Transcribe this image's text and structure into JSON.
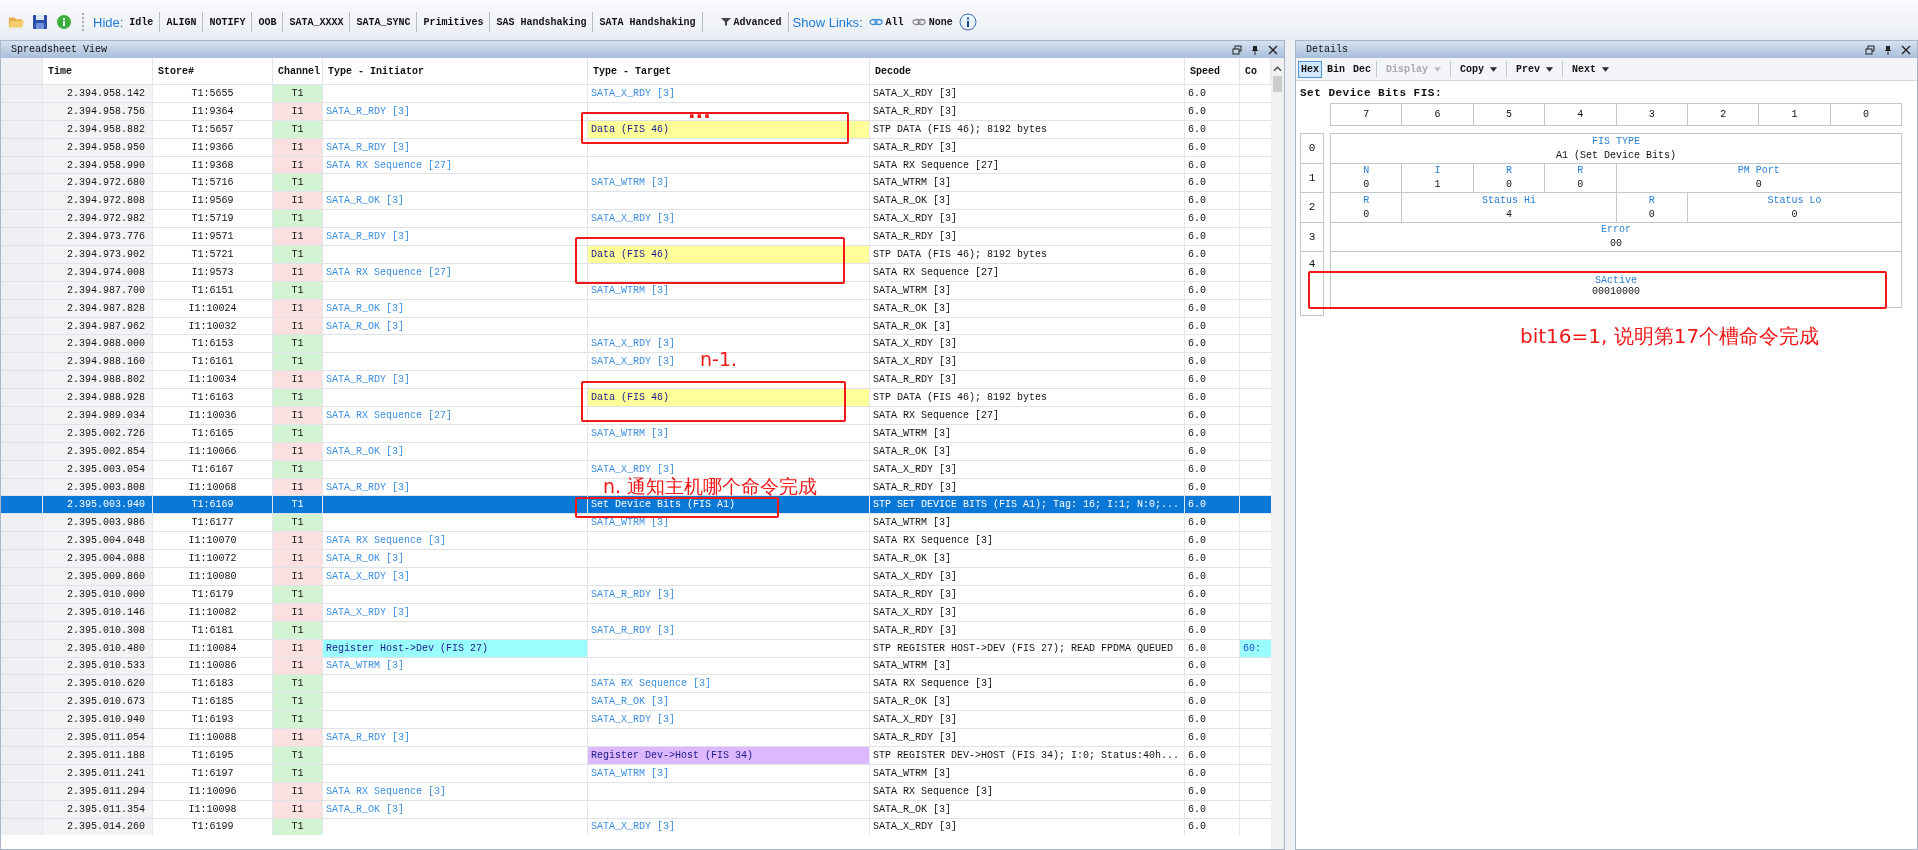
{
  "toolbar": {
    "hide_label": "Hide:",
    "filters": [
      "Idle",
      "ALIGN",
      "NOTIFY",
      "OOB",
      "SATA_XXXX",
      "SATA_SYNC",
      "Primitives",
      "SAS Handshaking",
      "SATA Handshaking"
    ],
    "advanced": "Advanced",
    "links_label": "Show Links:",
    "link_options": [
      "All",
      "None"
    ]
  },
  "spreadsheet": {
    "title": "Spreadsheet View",
    "columns": [
      "Time",
      "Store#",
      "Channel",
      "Type - Initiator",
      "Type - Target",
      "Decode",
      "Speed",
      "Co"
    ],
    "rows": [
      {
        "time": "2.394.958.142",
        "store": "T1:5655",
        "channel": {
          "text": "T1",
          "color": "#d3f3d3"
        },
        "target": {
          "text": "SATA_X_RDY [3]"
        },
        "decode": "SATA_X_RDY [3]",
        "speed": "6.0",
        "selected": false
      },
      {
        "time": "2.394.958.756",
        "store": "I1:9364",
        "channel": {
          "text": "I1",
          "color": "#fbe0e0"
        },
        "initiator": {
          "text": "SATA_R_RDY [3]"
        },
        "decode": "SATA_R_RDY [3]",
        "speed": "6.0",
        "selected": false
      },
      {
        "time": "2.394.958.882",
        "store": "T1:5657",
        "channel": {
          "text": "T1",
          "color": "#d3f3d3"
        },
        "target": {
          "text": "Data (FIS 46)",
          "color": "#ffff99"
        },
        "decode": "STP DATA (FIS 46); 8192 bytes",
        "speed": "6.0",
        "selected": false
      },
      {
        "time": "2.394.958.950",
        "store": "I1:9366",
        "channel": {
          "text": "I1",
          "color": "#fbe0e0"
        },
        "initiator": {
          "text": "SATA_R_RDY [3]"
        },
        "decode": "SATA_R_RDY [3]",
        "speed": "6.0",
        "selected": false
      },
      {
        "time": "2.394.958.990",
        "store": "I1:9368",
        "channel": {
          "text": "I1",
          "color": "#fbe0e0"
        },
        "initiator": {
          "text": "SATA RX Sequence [27]"
        },
        "decode": "SATA RX Sequence [27]",
        "speed": "6.0",
        "selected": false
      },
      {
        "time": "2.394.972.680",
        "store": "T1:5716",
        "channel": {
          "text": "T1",
          "color": "#d3f3d3"
        },
        "target": {
          "text": "SATA_WTRM [3]"
        },
        "decode": "SATA_WTRM [3]",
        "speed": "6.0",
        "selected": false
      },
      {
        "time": "2.394.972.808",
        "store": "I1:9569",
        "channel": {
          "text": "I1",
          "color": "#fbe0e0"
        },
        "initiator": {
          "text": "SATA_R_OK [3]"
        },
        "decode": "SATA_R_OK [3]",
        "speed": "6.0",
        "selected": false
      },
      {
        "time": "2.394.972.982",
        "store": "T1:5719",
        "channel": {
          "text": "T1",
          "color": "#d3f3d3"
        },
        "target": {
          "text": "SATA_X_RDY [3]"
        },
        "decode": "SATA_X_RDY [3]",
        "speed": "6.0",
        "selected": false
      },
      {
        "time": "2.394.973.776",
        "store": "I1:9571",
        "channel": {
          "text": "I1",
          "color": "#fbe0e0"
        },
        "initiator": {
          "text": "SATA_R_RDY [3]"
        },
        "decode": "SATA_R_RDY [3]",
        "speed": "6.0",
        "selected": false
      },
      {
        "time": "2.394.973.902",
        "store": "T1:5721",
        "channel": {
          "text": "T1",
          "color": "#d3f3d3"
        },
        "target": {
          "text": "Data (FIS 46)",
          "color": "#ffff99"
        },
        "decode": "STP DATA (FIS 46); 8192 bytes",
        "speed": "6.0",
        "selected": false
      },
      {
        "time": "2.394.974.008",
        "store": "I1:9573",
        "channel": {
          "text": "I1",
          "color": "#fbe0e0"
        },
        "initiator": {
          "text": "SATA RX Sequence [27]"
        },
        "decode": "SATA RX Sequence [27]",
        "speed": "6.0",
        "selected": false
      },
      {
        "time": "2.394.987.700",
        "store": "T1:6151",
        "channel": {
          "text": "T1",
          "color": "#d3f3d3"
        },
        "target": {
          "text": "SATA_WTRM [3]"
        },
        "decode": "SATA_WTRM [3]",
        "speed": "6.0",
        "selected": false
      },
      {
        "time": "2.394.987.828",
        "store": "I1:10024",
        "channel": {
          "text": "I1",
          "color": "#fbe0e0"
        },
        "initiator": {
          "text": "SATA_R_OK [3]"
        },
        "decode": "SATA_R_OK [3]",
        "speed": "6.0",
        "selected": false
      },
      {
        "time": "2.394.987.962",
        "store": "I1:10032",
        "channel": {
          "text": "I1",
          "color": "#fbe0e0"
        },
        "initiator": {
          "text": "SATA_R_OK [3]"
        },
        "decode": "SATA_R_OK [3]",
        "speed": "6.0",
        "selected": false
      },
      {
        "time": "2.394.988.000",
        "store": "T1:6153",
        "channel": {
          "text": "T1",
          "color": "#d3f3d3"
        },
        "target": {
          "text": "SATA_X_RDY [3]"
        },
        "decode": "SATA_X_RDY [3]",
        "speed": "6.0",
        "selected": false
      },
      {
        "time": "2.394.988.160",
        "store": "T1:6161",
        "channel": {
          "text": "T1",
          "color": "#d3f3d3"
        },
        "target": {
          "text": "SATA_X_RDY [3]"
        },
        "decode": "SATA_X_RDY [3]",
        "speed": "6.0",
        "selected": false
      },
      {
        "time": "2.394.988.802",
        "store": "I1:10034",
        "channel": {
          "text": "I1",
          "color": "#fbe0e0"
        },
        "initiator": {
          "text": "SATA_R_RDY [3]"
        },
        "decode": "SATA_R_RDY [3]",
        "speed": "6.0",
        "selected": false
      },
      {
        "time": "2.394.988.928",
        "store": "T1:6163",
        "channel": {
          "text": "T1",
          "color": "#d3f3d3"
        },
        "target": {
          "text": "Data (FIS 46)",
          "color": "#ffff99"
        },
        "decode": "STP DATA (FIS 46); 8192 bytes",
        "speed": "6.0",
        "selected": false
      },
      {
        "time": "2.394.989.034",
        "store": "I1:10036",
        "channel": {
          "text": "I1",
          "color": "#fbe0e0"
        },
        "initiator": {
          "text": "SATA RX Sequence [27]"
        },
        "decode": "SATA RX Sequence [27]",
        "speed": "6.0",
        "selected": false
      },
      {
        "time": "2.395.002.726",
        "store": "T1:6165",
        "channel": {
          "text": "T1",
          "color": "#d3f3d3"
        },
        "target": {
          "text": "SATA_WTRM [3]"
        },
        "decode": "SATA_WTRM [3]",
        "speed": "6.0",
        "selected": false
      },
      {
        "time": "2.395.002.854",
        "store": "I1:10066",
        "channel": {
          "text": "I1",
          "color": "#fbe0e0"
        },
        "initiator": {
          "text": "SATA_R_OK [3]"
        },
        "decode": "SATA_R_OK [3]",
        "speed": "6.0",
        "selected": false
      },
      {
        "time": "2.395.003.054",
        "store": "T1:6167",
        "channel": {
          "text": "T1",
          "color": "#d3f3d3"
        },
        "target": {
          "text": "SATA_X_RDY [3]"
        },
        "decode": "SATA_X_RDY [3]",
        "speed": "6.0",
        "selected": false
      },
      {
        "time": "2.395.003.808",
        "store": "I1:10068",
        "channel": {
          "text": "I1",
          "color": "#fbe0e0"
        },
        "initiator": {
          "text": "SATA_R_RDY [3]"
        },
        "decode": "SATA_R_RDY [3]",
        "speed": "6.0",
        "selected": false
      },
      {
        "time": "2.395.003.940",
        "store": "T1:6169",
        "channel": {
          "text": "T1"
        },
        "target": {
          "text": "Set Device Bits (FIS A1)"
        },
        "decode": "STP SET DEVICE BITS (FIS A1); Tag: 16; I:1; N:0;...",
        "speed": "6.0",
        "selected": true
      },
      {
        "time": "2.395.003.986",
        "store": "T1:6177",
        "channel": {
          "text": "T1",
          "color": "#d3f3d3"
        },
        "target": {
          "text": "SATA_WTRM [3]"
        },
        "decode": "SATA_WTRM [3]",
        "speed": "6.0",
        "selected": false
      },
      {
        "time": "2.395.004.048",
        "store": "I1:10070",
        "channel": {
          "text": "I1",
          "color": "#fbe0e0"
        },
        "initiator": {
          "text": "SATA RX Sequence [3]"
        },
        "decode": "SATA RX Sequence [3]",
        "speed": "6.0",
        "selected": false
      },
      {
        "time": "2.395.004.088",
        "store": "I1:10072",
        "channel": {
          "text": "I1",
          "color": "#fbe0e0"
        },
        "initiator": {
          "text": "SATA_R_OK [3]"
        },
        "decode": "SATA_R_OK [3]",
        "speed": "6.0",
        "selected": false
      },
      {
        "time": "2.395.009.860",
        "store": "I1:10080",
        "channel": {
          "text": "I1",
          "color": "#fbe0e0"
        },
        "initiator": {
          "text": "SATA_X_RDY [3]"
        },
        "decode": "SATA_X_RDY [3]",
        "speed": "6.0",
        "selected": false
      },
      {
        "time": "2.395.010.000",
        "store": "T1:6179",
        "channel": {
          "text": "T1",
          "color": "#d3f3d3"
        },
        "target": {
          "text": "SATA_R_RDY [3]"
        },
        "decode": "SATA_R_RDY [3]",
        "speed": "6.0",
        "selected": false
      },
      {
        "time": "2.395.010.146",
        "store": "I1:10082",
        "channel": {
          "text": "I1",
          "color": "#fbe0e0"
        },
        "initiator": {
          "text": "SATA_X_RDY [3]"
        },
        "decode": "SATA_X_RDY [3]",
        "speed": "6.0",
        "selected": false
      },
      {
        "time": "2.395.010.308",
        "store": "T1:6181",
        "channel": {
          "text": "T1",
          "color": "#d3f3d3"
        },
        "target": {
          "text": "SATA_R_RDY [3]"
        },
        "decode": "SATA_R_RDY [3]",
        "speed": "6.0",
        "selected": false
      },
      {
        "time": "2.395.010.480",
        "store": "I1:10084",
        "channel": {
          "text": "I1",
          "color": "#fbe0e0"
        },
        "initiator": {
          "text": "Register Host->Dev (FIS 27)",
          "color": "#99ffff"
        },
        "decode": "STP REGISTER HOST->DEV (FIS 27); READ FPDMA QUEUED",
        "speed": "6.0",
        "comment": {
          "text": "60:",
          "color": "#99ffff"
        },
        "selected": false
      },
      {
        "time": "2.395.010.533",
        "store": "I1:10086",
        "channel": {
          "text": "I1",
          "color": "#fbe0e0"
        },
        "initiator": {
          "text": "SATA_WTRM [3]"
        },
        "decode": "SATA_WTRM [3]",
        "speed": "6.0",
        "selected": false
      },
      {
        "time": "2.395.010.620",
        "store": "T1:6183",
        "channel": {
          "text": "T1",
          "color": "#d3f3d3"
        },
        "target": {
          "text": "SATA RX Sequence [3]"
        },
        "decode": "SATA RX Sequence [3]",
        "speed": "6.0",
        "selected": false
      },
      {
        "time": "2.395.010.673",
        "store": "T1:6185",
        "channel": {
          "text": "T1",
          "color": "#d3f3d3"
        },
        "target": {
          "text": "SATA_R_OK [3]"
        },
        "decode": "SATA_R_OK [3]",
        "speed": "6.0",
        "selected": false
      },
      {
        "time": "2.395.010.940",
        "store": "T1:6193",
        "channel": {
          "text": "T1",
          "color": "#d3f3d3"
        },
        "target": {
          "text": "SATA_X_RDY [3]"
        },
        "decode": "SATA_X_RDY [3]",
        "speed": "6.0",
        "selected": false
      },
      {
        "time": "2.395.011.054",
        "store": "I1:10088",
        "channel": {
          "text": "I1",
          "color": "#fbe0e0"
        },
        "initiator": {
          "text": "SATA_R_RDY [3]"
        },
        "decode": "SATA_R_RDY [3]",
        "speed": "6.0",
        "selected": false
      },
      {
        "time": "2.395.011.188",
        "store": "T1:6195",
        "channel": {
          "text": "T1",
          "color": "#d3f3d3"
        },
        "target": {
          "text": "Register Dev->Host (FIS 34)",
          "color": "#ddb8ff"
        },
        "decode": "STP REGISTER DEV->HOST (FIS 34); I:0; Status:40h...",
        "speed": "6.0",
        "selected": false
      },
      {
        "time": "2.395.011.241",
        "store": "T1:6197",
        "channel": {
          "text": "T1",
          "color": "#d3f3d3"
        },
        "target": {
          "text": "SATA_WTRM [3]"
        },
        "decode": "SATA_WTRM [3]",
        "speed": "6.0",
        "selected": false
      },
      {
        "time": "2.395.011.294",
        "store": "I1:10096",
        "channel": {
          "text": "I1",
          "color": "#fbe0e0"
        },
        "initiator": {
          "text": "SATA RX Sequence [3]"
        },
        "decode": "SATA RX Sequence [3]",
        "speed": "6.0",
        "selected": false
      },
      {
        "time": "2.395.011.354",
        "store": "I1:10098",
        "channel": {
          "text": "I1",
          "color": "#fbe0e0"
        },
        "initiator": {
          "text": "SATA_R_OK [3]"
        },
        "decode": "SATA_R_OK [3]",
        "speed": "6.0",
        "selected": false
      },
      {
        "time": "2.395.014.260",
        "store": "T1:6199",
        "channel": {
          "text": "T1",
          "color": "#d3f3d3"
        },
        "target": {
          "text": "SATA_X_RDY [3]"
        },
        "decode": "SATA_X_RDY [3]",
        "speed": "6.0",
        "selected": false
      }
    ]
  },
  "details": {
    "title": "Details",
    "view_modes": [
      {
        "label": "Hex",
        "selected": true
      },
      {
        "label": "Bin",
        "selected": false
      },
      {
        "label": "Dec",
        "selected": false
      }
    ],
    "actions": [
      {
        "label": "Display",
        "disabled": true
      },
      {
        "label": "Copy",
        "disabled": false
      },
      {
        "label": "Prev",
        "disabled": false
      },
      {
        "label": "Next",
        "disabled": false
      }
    ],
    "fis_title": "Set Device Bits FIS:",
    "bit_headers": [
      "7",
      "6",
      "5",
      "4",
      "3",
      "2",
      "1",
      "0"
    ],
    "fis_rows": [
      {
        "index": "0",
        "kind": "byte",
        "fields": [
          {
            "label": "FIS TYPE",
            "value": "A1 (Set Device Bits)",
            "kind": "byte"
          }
        ]
      },
      {
        "index": "1",
        "kind": "byte",
        "fields": [
          {
            "label": "N",
            "value": "0",
            "kind": "bit"
          },
          {
            "label": "I",
            "value": "1",
            "kind": "bit"
          },
          {
            "label": "R",
            "value": "0",
            "kind": "bit"
          },
          {
            "label": "R",
            "value": "0",
            "kind": "bit"
          },
          {
            "label": "PM Port",
            "value": "0",
            "kind": "nibble"
          }
        ]
      },
      {
        "index": "2",
        "kind": "byte",
        "fields": [
          {
            "label": "R",
            "value": "0",
            "kind": "bit"
          },
          {
            "label": "Status Hi",
            "value": "4",
            "kind": "trio"
          },
          {
            "label": "R",
            "value": "0",
            "kind": "bit"
          },
          {
            "label": "Status Lo",
            "value": "0",
            "kind": "trio"
          }
        ]
      },
      {
        "index": "3",
        "kind": "byte",
        "fields": [
          {
            "label": "Error",
            "value": "00",
            "kind": "byte"
          }
        ]
      },
      {
        "index": "4",
        "kind": "dword",
        "fields": [
          {
            "label": "SActive",
            "value": "00010000",
            "kind": "byte"
          }
        ]
      }
    ]
  },
  "annotations": [
    {
      "kind": "box"
    },
    {
      "kind": "text",
      "text": "..."
    },
    {
      "kind": "box"
    },
    {
      "kind": "text",
      "text": "n-1."
    },
    {
      "kind": "box"
    },
    {
      "kind": "text",
      "text": "n. 通知主机哪个命令完成"
    },
    {
      "kind": "box"
    },
    {
      "kind": "box"
    },
    {
      "kind": "text",
      "text": "bit16=1, 说明第17个槽命令完成"
    }
  ]
}
